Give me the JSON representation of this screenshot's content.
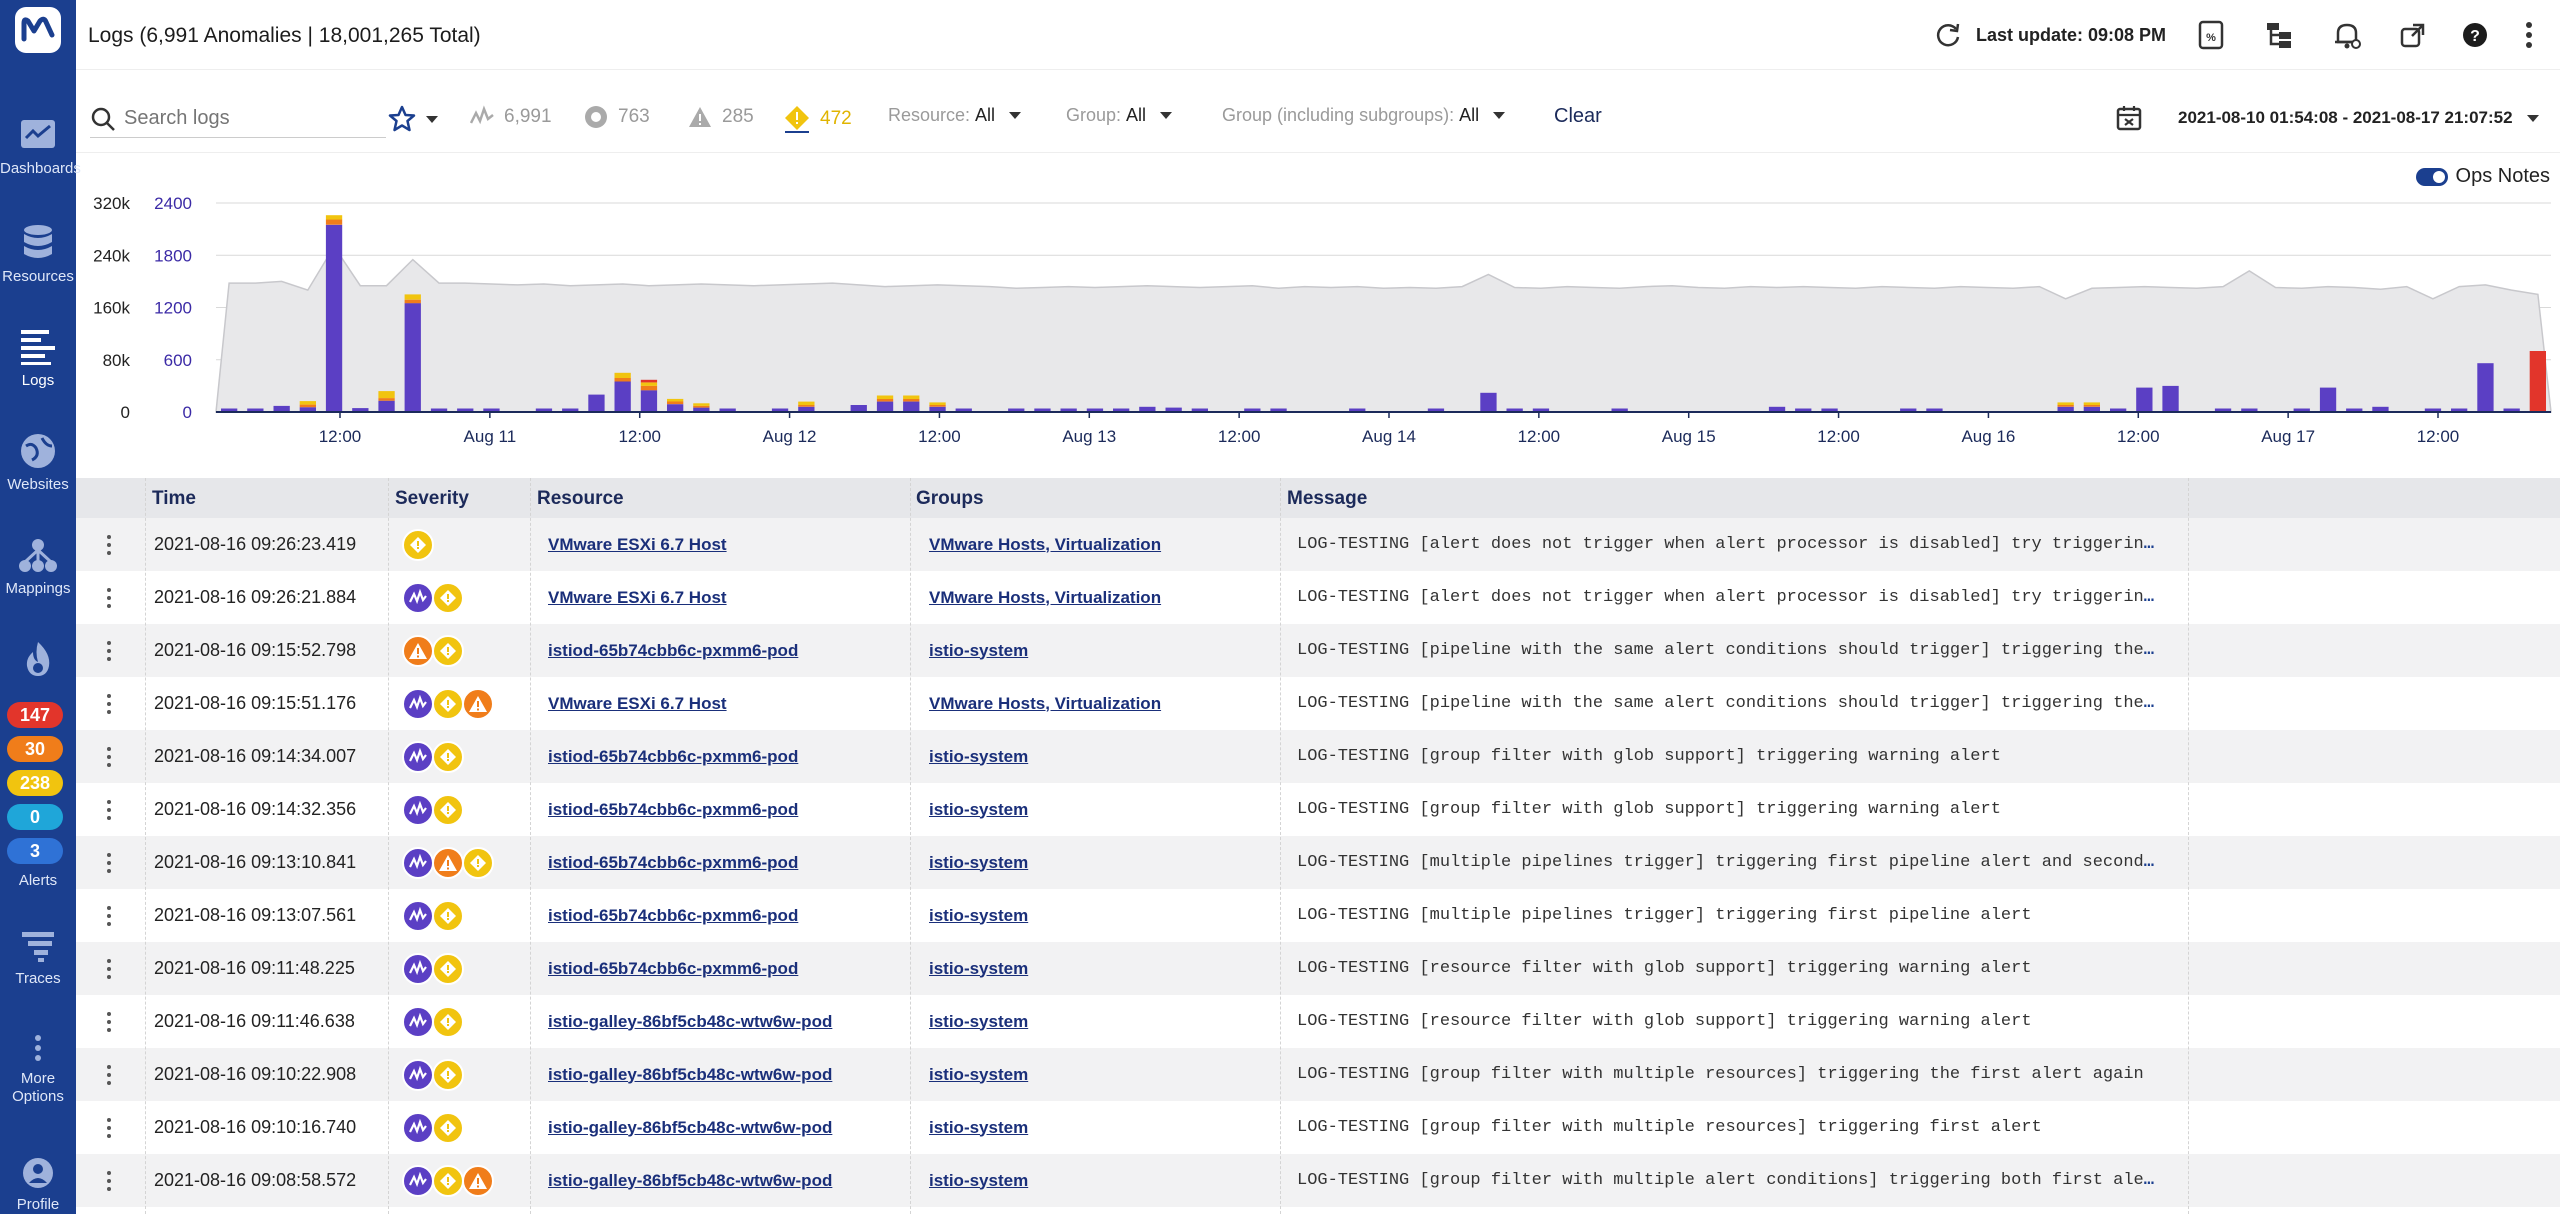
{
  "sidebar": {
    "items": [
      {
        "label": "Dashboards",
        "icon": "dashboards-icon"
      },
      {
        "label": "Resources",
        "icon": "resources-icon"
      },
      {
        "label": "Logs",
        "icon": "logs-icon"
      },
      {
        "label": "Websites",
        "icon": "websites-icon"
      },
      {
        "label": "Mappings",
        "icon": "mappings-icon"
      },
      {
        "label": "Alerts",
        "icon": "alerts-icon"
      },
      {
        "label": "Traces",
        "icon": "traces-icon"
      },
      {
        "label": "More Options",
        "icon": "more-options-icon"
      },
      {
        "label": "Profile",
        "icon": "profile-icon"
      }
    ],
    "alert_counts": [
      {
        "value": "147",
        "color": "#e2352b"
      },
      {
        "value": "30",
        "color": "#f07d1a"
      },
      {
        "value": "238",
        "color": "#f1c40f"
      },
      {
        "value": "0",
        "color": "#1fa6d9"
      },
      {
        "value": "3",
        "color": "#2f72d6"
      }
    ]
  },
  "header": {
    "title": "Logs (6,991 Anomalies | 18,001,265 Total)",
    "last_update": "Last update: 09:08 PM"
  },
  "filters": {
    "search_placeholder": "Search logs",
    "anomalies_count": "6,991",
    "critical_count": "763",
    "error_count": "285",
    "warning_count": "472",
    "resource_label": "Resource:",
    "resource_value": "All",
    "group_label": "Group:",
    "group_value": "All",
    "group_sub_label": "Group (including subgroups):",
    "group_sub_value": "All",
    "clear_label": "Clear",
    "date_range": "2021-08-10 01:54:08 - 2021-08-17 21:07:52"
  },
  "ops_notes_label": "Ops Notes",
  "chart_data": {
    "type": "bar",
    "left_axis_ticks": [
      "320k",
      "240k",
      "160k",
      "80k",
      "0"
    ],
    "right_axis_ticks": [
      "2400",
      "1800",
      "1200",
      "600",
      "0"
    ],
    "x_tick_labels": [
      "12:00",
      "Aug 11",
      "12:00",
      "Aug 12",
      "12:00",
      "Aug 13",
      "12:00",
      "Aug 14",
      "12:00",
      "Aug 15",
      "12:00",
      "Aug 16",
      "12:00",
      "Aug 17",
      "12:00"
    ],
    "colors": {
      "anomaly": "#5b3fc4",
      "warning": "#f1c40f",
      "error": "#f07d1a",
      "critical": "#e2352b",
      "total_area": "#e8e8ea"
    },
    "anomaly_values": [
      40,
      40,
      70,
      55,
      2150,
      45,
      130,
      1250,
      40,
      40,
      40,
      0,
      40,
      40,
      200,
      350,
      250,
      90,
      50,
      40,
      0,
      40,
      60,
      0,
      80,
      120,
      120,
      60,
      40,
      0,
      40,
      40,
      40,
      40,
      40,
      60,
      50,
      40,
      0,
      40,
      40,
      0,
      0,
      40,
      0,
      0,
      40,
      0,
      220,
      40,
      40,
      0,
      0,
      40,
      0,
      0,
      0,
      0,
      0,
      60,
      40,
      40,
      0,
      0,
      40,
      40,
      0,
      0,
      0,
      0,
      60,
      60,
      40,
      280,
      300,
      0,
      40,
      40,
      0,
      40,
      280,
      40,
      60,
      0,
      40,
      40,
      560,
      40,
      0
    ],
    "warning_values": [
      0,
      0,
      0,
      40,
      50,
      0,
      80,
      60,
      0,
      0,
      0,
      0,
      0,
      0,
      0,
      60,
      40,
      30,
      30,
      0,
      0,
      0,
      40,
      0,
      0,
      40,
      40,
      30,
      0,
      0,
      0,
      0,
      0,
      0,
      0,
      0,
      0,
      0,
      0,
      0,
      0,
      0,
      0,
      0,
      0,
      0,
      0,
      0,
      0,
      0,
      0,
      0,
      0,
      0,
      0,
      0,
      0,
      0,
      0,
      0,
      0,
      0,
      0,
      0,
      0,
      0,
      0,
      0,
      0,
      0,
      30,
      30,
      0,
      0,
      0,
      0,
      0,
      0,
      0,
      0,
      0,
      0,
      0,
      0,
      0,
      0,
      0,
      0,
      0
    ],
    "error_values": [
      0,
      0,
      0,
      30,
      60,
      0,
      30,
      40,
      0,
      0,
      0,
      0,
      0,
      0,
      0,
      40,
      50,
      30,
      20,
      0,
      0,
      0,
      20,
      0,
      0,
      30,
      30,
      20,
      0,
      0,
      0,
      0,
      0,
      0,
      0,
      0,
      0,
      0,
      0,
      0,
      0,
      0,
      0,
      0,
      0,
      0,
      0,
      0,
      0,
      0,
      0,
      0,
      0,
      0,
      0,
      0,
      0,
      0,
      0,
      0,
      0,
      0,
      0,
      0,
      0,
      0,
      0,
      0,
      0,
      0,
      20,
      20,
      0,
      0,
      0,
      0,
      0,
      0,
      0,
      0,
      0,
      0,
      0,
      0,
      0,
      0,
      0,
      0,
      0
    ],
    "critical_values": [
      0,
      0,
      0,
      0,
      0,
      0,
      0,
      0,
      0,
      0,
      0,
      0,
      0,
      0,
      0,
      0,
      30,
      0,
      0,
      0,
      0,
      0,
      0,
      0,
      0,
      0,
      0,
      0,
      0,
      0,
      0,
      0,
      0,
      0,
      0,
      0,
      0,
      0,
      0,
      0,
      0,
      0,
      0,
      0,
      0,
      0,
      0,
      0,
      0,
      0,
      0,
      0,
      0,
      0,
      0,
      0,
      0,
      0,
      0,
      0,
      0,
      0,
      0,
      0,
      0,
      0,
      0,
      0,
      0,
      0,
      0,
      0,
      0,
      0,
      0,
      0,
      0,
      0,
      0,
      0,
      0,
      0,
      0,
      0,
      0,
      0,
      0,
      0,
      700
    ],
    "total_values": [
      1480,
      1480,
      1500,
      1400,
      1900,
      1450,
      1450,
      1750,
      1480,
      1480,
      1470,
      1460,
      1470,
      1450,
      1460,
      1470,
      1450,
      1460,
      1470,
      1460,
      1450,
      1460,
      1470,
      1480,
      1460,
      1440,
      1450,
      1460,
      1450,
      1440,
      1420,
      1430,
      1440,
      1430,
      1440,
      1450,
      1440,
      1430,
      1440,
      1450,
      1420,
      1440,
      1430,
      1440,
      1420,
      1430,
      1420,
      1440,
      1580,
      1430,
      1420,
      1440,
      1430,
      1420,
      1440,
      1450,
      1430,
      1420,
      1440,
      1430,
      1440,
      1430,
      1420,
      1440,
      1430,
      1420,
      1440,
      1430,
      1420,
      1440,
      1300,
      1420,
      1430,
      1440,
      1430,
      1420,
      1440,
      1620,
      1430,
      1420,
      1440,
      1430,
      1410,
      1440,
      1300,
      1440,
      1460,
      1400,
      1350
    ]
  },
  "table": {
    "columns": {
      "time": "Time",
      "severity": "Severity",
      "resource": "Resource",
      "groups": "Groups",
      "message": "Message"
    },
    "rows": [
      {
        "time": "2021-08-16 09:26:23.419",
        "sev": [
          "warning"
        ],
        "resource": "VMware ESXi 6.7 Host",
        "groups": "VMware Hosts, Virtualization",
        "message": "LOG-TESTING [alert does not trigger when alert processor is disabled] try triggerin",
        "truncated": true
      },
      {
        "time": "2021-08-16 09:26:21.884",
        "sev": [
          "anomaly",
          "warning"
        ],
        "resource": "VMware ESXi 6.7 Host",
        "groups": "VMware Hosts, Virtualization",
        "message": "LOG-TESTING [alert does not trigger when alert processor is disabled] try triggerin",
        "truncated": true
      },
      {
        "time": "2021-08-16 09:15:52.798",
        "sev": [
          "error",
          "warning"
        ],
        "resource": "istiod-65b74cbb6c-pxmm6-pod",
        "groups": "istio-system",
        "message": "LOG-TESTING [pipeline with the same alert conditions should trigger] triggering the",
        "truncated": true
      },
      {
        "time": "2021-08-16 09:15:51.176",
        "sev": [
          "anomaly",
          "warning",
          "error"
        ],
        "resource": "VMware ESXi 6.7 Host",
        "groups": "VMware Hosts, Virtualization",
        "message": "LOG-TESTING [pipeline with the same alert conditions should trigger] triggering the",
        "truncated": true
      },
      {
        "time": "2021-08-16 09:14:34.007",
        "sev": [
          "anomaly",
          "warning"
        ],
        "resource": "istiod-65b74cbb6c-pxmm6-pod",
        "groups": "istio-system",
        "message": "LOG-TESTING [group filter with glob support] triggering warning alert",
        "truncated": false
      },
      {
        "time": "2021-08-16 09:14:32.356",
        "sev": [
          "anomaly",
          "warning"
        ],
        "resource": "istiod-65b74cbb6c-pxmm6-pod",
        "groups": "istio-system",
        "message": "LOG-TESTING [group filter with glob support] triggering warning alert",
        "truncated": false
      },
      {
        "time": "2021-08-16 09:13:10.841",
        "sev": [
          "anomaly",
          "error",
          "warning"
        ],
        "resource": "istiod-65b74cbb6c-pxmm6-pod",
        "groups": "istio-system",
        "message": "LOG-TESTING [multiple pipelines trigger] triggering first pipeline alert and second",
        "truncated": true
      },
      {
        "time": "2021-08-16 09:13:07.561",
        "sev": [
          "anomaly",
          "warning"
        ],
        "resource": "istiod-65b74cbb6c-pxmm6-pod",
        "groups": "istio-system",
        "message": "LOG-TESTING [multiple pipelines trigger] triggering first pipeline alert",
        "truncated": false
      },
      {
        "time": "2021-08-16 09:11:48.225",
        "sev": [
          "anomaly",
          "warning"
        ],
        "resource": "istiod-65b74cbb6c-pxmm6-pod",
        "groups": "istio-system",
        "message": "LOG-TESTING [resource filter with glob support] triggering warning alert",
        "truncated": false
      },
      {
        "time": "2021-08-16 09:11:46.638",
        "sev": [
          "anomaly",
          "warning"
        ],
        "resource": "istio-galley-86bf5cb48c-wtw6w-pod",
        "groups": "istio-system",
        "message": "LOG-TESTING [resource filter with glob support] triggering warning alert",
        "truncated": false
      },
      {
        "time": "2021-08-16 09:10:22.908",
        "sev": [
          "anomaly",
          "warning"
        ],
        "resource": "istio-galley-86bf5cb48c-wtw6w-pod",
        "groups": "istio-system",
        "message": "LOG-TESTING [group filter with multiple resources] triggering the first alert again",
        "truncated": false
      },
      {
        "time": "2021-08-16 09:10:16.740",
        "sev": [
          "anomaly",
          "warning"
        ],
        "resource": "istio-galley-86bf5cb48c-wtw6w-pod",
        "groups": "istio-system",
        "message": "LOG-TESTING [group filter with multiple resources] triggering first alert",
        "truncated": false
      },
      {
        "time": "2021-08-16 09:08:58.572",
        "sev": [
          "anomaly",
          "warning",
          "error"
        ],
        "resource": "istio-galley-86bf5cb48c-wtw6w-pod",
        "groups": "istio-system",
        "message": "LOG-TESTING [group filter with multiple alert conditions] triggering both first ale",
        "truncated": true
      }
    ]
  }
}
